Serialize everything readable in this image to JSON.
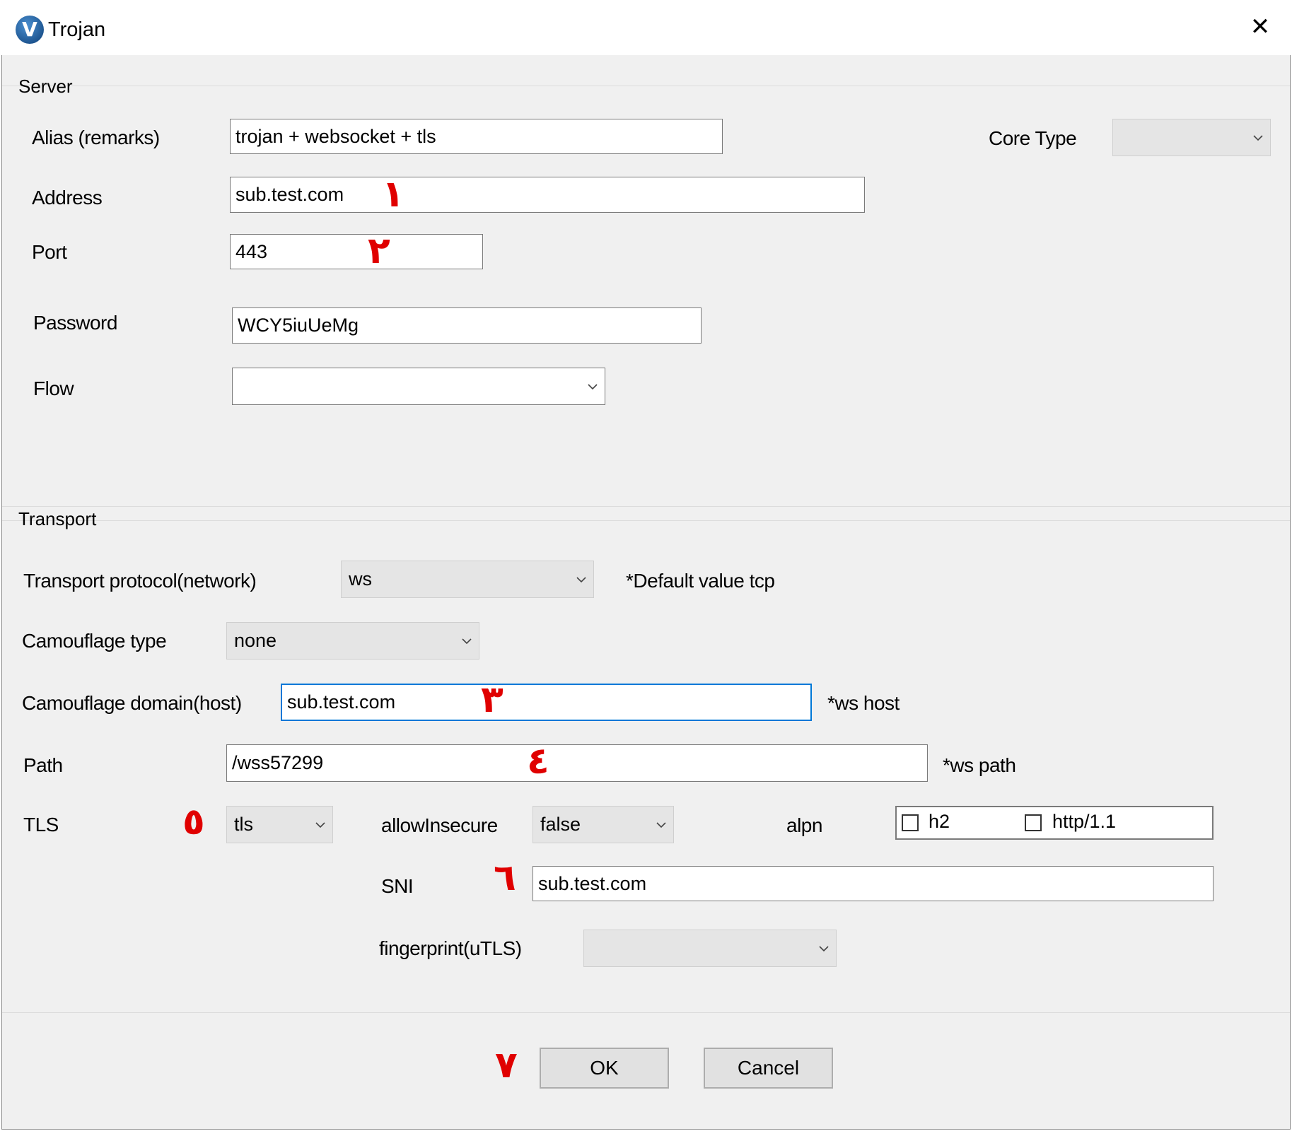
{
  "window": {
    "title": "Trojan",
    "app_icon": "v2rayn-logo",
    "close_glyph": "✕"
  },
  "server": {
    "section_title": "Server",
    "alias_label": "Alias (remarks)",
    "alias_value": "trojan + websocket + tls",
    "core_type_label": "Core Type",
    "core_type_value": "",
    "address_label": "Address",
    "address_value": "sub.test.com",
    "port_label": "Port",
    "port_value": "443",
    "password_label": "Password",
    "password_value": "WCY5iuUeMg",
    "flow_label": "Flow",
    "flow_value": ""
  },
  "transport": {
    "section_title": "Transport",
    "network_label": "Transport protocol(network)",
    "network_value": "ws",
    "network_hint": "*Default value tcp",
    "camouflage_type_label": "Camouflage type",
    "camouflage_type_value": "none",
    "host_label": "Camouflage domain(host)",
    "host_value": "sub.test.com",
    "host_hint": "*ws host",
    "path_label": "Path",
    "path_value": "/wss57299",
    "path_hint": "*ws path",
    "tls_label": "TLS",
    "tls_value": "tls",
    "allow_insecure_label": "allowInsecure",
    "allow_insecure_value": "false",
    "alpn_label": "alpn",
    "alpn_options": [
      {
        "label": "h2",
        "checked": false
      },
      {
        "label": "http/1.1",
        "checked": false
      }
    ],
    "sni_label": "SNI",
    "sni_value": "sub.test.com",
    "fingerprint_label": "fingerprint(uTLS)",
    "fingerprint_value": ""
  },
  "buttons": {
    "ok": "OK",
    "cancel": "Cancel"
  },
  "annotations": {
    "marker_1": "١",
    "marker_2": "٢",
    "marker_3": "٣",
    "marker_4": "٤",
    "marker_5": "٥",
    "marker_6": "٦",
    "marker_7": "٧",
    "color": "#e00000"
  },
  "colors": {
    "focus_border": "#0078d7",
    "client_bg": "#f0f0f0",
    "combo_bg": "#e5e5e5"
  }
}
